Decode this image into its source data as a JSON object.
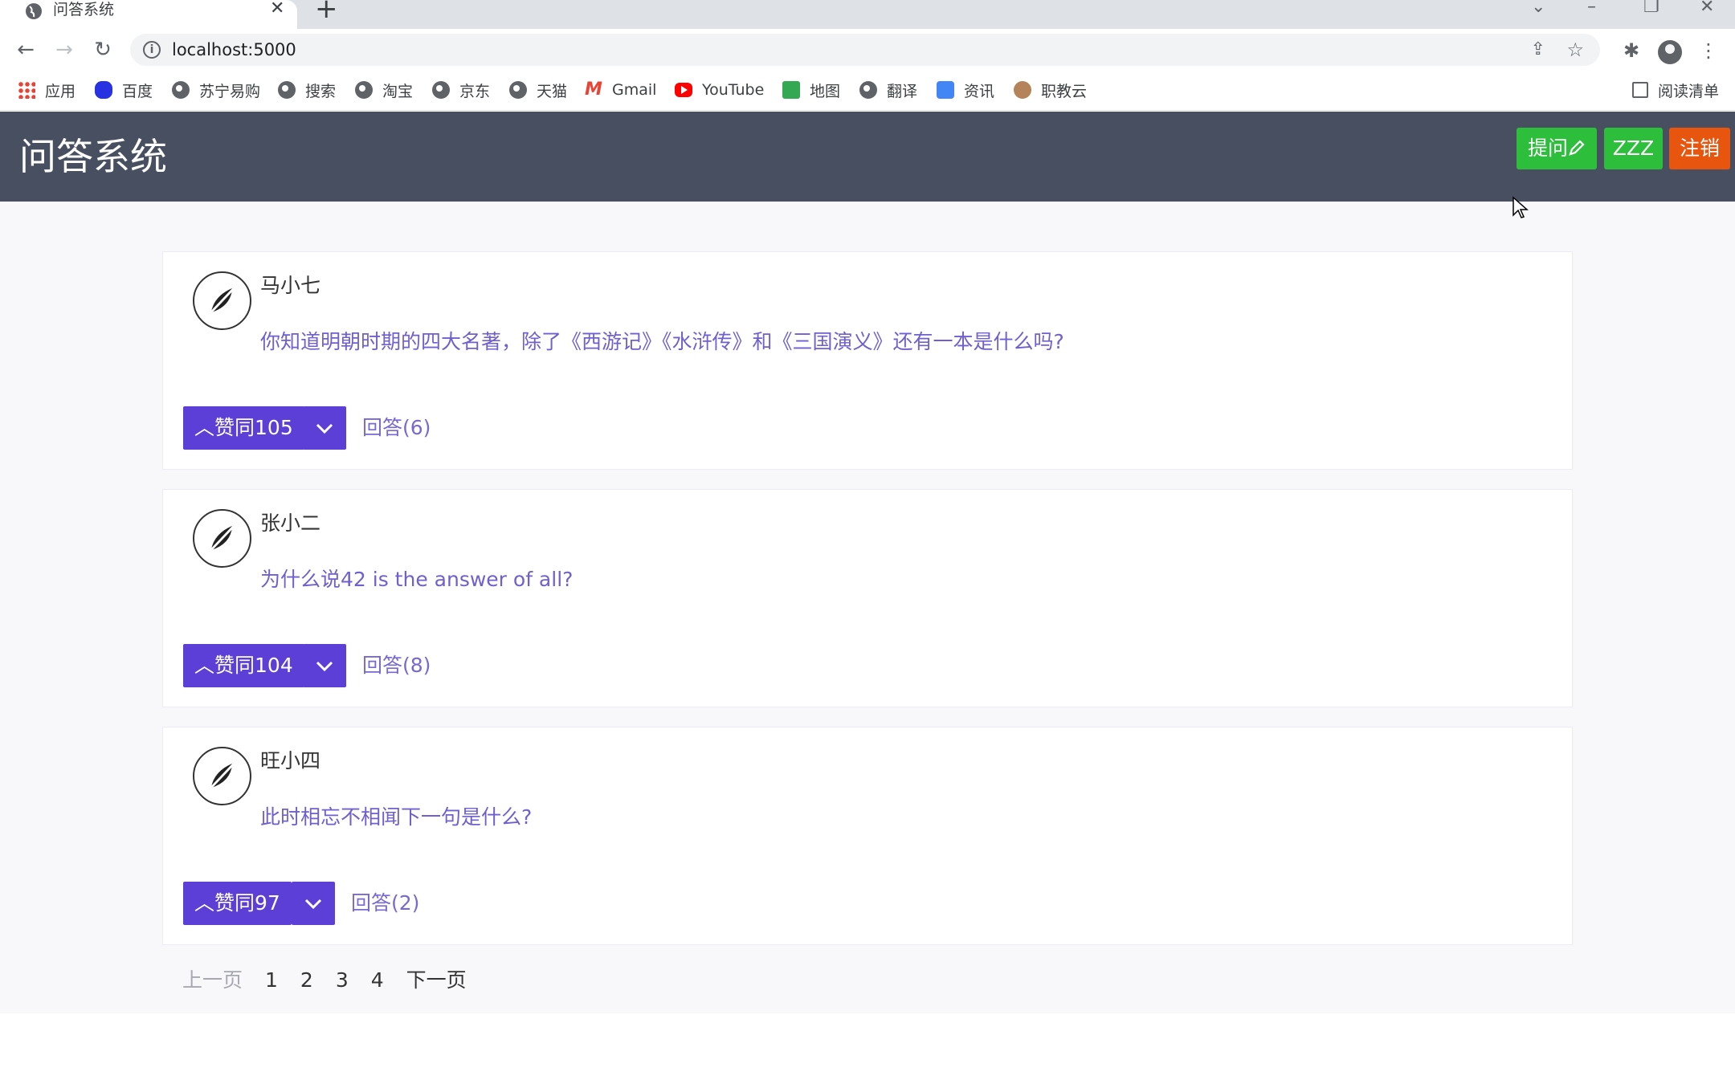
{
  "browser": {
    "tab_title": "问答系统",
    "url": "localhost:5000",
    "bookmarks": [
      {
        "label": "应用",
        "icon": "apps-icon"
      },
      {
        "label": "百度",
        "icon": "baidu-icon"
      },
      {
        "label": "苏宁易购",
        "icon": "globe-icon"
      },
      {
        "label": "搜索",
        "icon": "globe-icon"
      },
      {
        "label": "淘宝",
        "icon": "globe-icon"
      },
      {
        "label": "京东",
        "icon": "globe-icon"
      },
      {
        "label": "天猫",
        "icon": "globe-icon"
      },
      {
        "label": "Gmail",
        "icon": "gmail-icon"
      },
      {
        "label": "YouTube",
        "icon": "youtube-icon"
      },
      {
        "label": "地图",
        "icon": "maps-icon"
      },
      {
        "label": "翻译",
        "icon": "globe-icon"
      },
      {
        "label": "资讯",
        "icon": "news-icon"
      },
      {
        "label": "职教云",
        "icon": "zjy-icon"
      }
    ],
    "reading_list": "阅读清单"
  },
  "header": {
    "brand": "问答系统",
    "ask_label": "提问",
    "user_label": "ZZZ",
    "logout_label": "注销",
    "colors": {
      "bar": "#484f60",
      "green": "#2dbf3c",
      "orange": "#e8550f"
    }
  },
  "questions": [
    {
      "user": "马小七",
      "text": "你知道明朝时期的四大名著，除了《西游记》《水浒传》和《三国演义》还有一本是什么吗?",
      "vote_label": "赞同105",
      "answers_label": "回答(6)"
    },
    {
      "user": "张小二",
      "text": "为什么说42 is the answer of all?",
      "vote_label": "赞同104",
      "answers_label": "回答(8)"
    },
    {
      "user": "旺小四",
      "text": "此时相忘不相闻下一句是什么?",
      "vote_label": "赞同97",
      "answers_label": "回答(2)"
    }
  ],
  "pagination": {
    "prev": "上一页",
    "pages": [
      "1",
      "2",
      "3",
      "4"
    ],
    "next": "下一页"
  },
  "accent_color": "#5b3fd6"
}
